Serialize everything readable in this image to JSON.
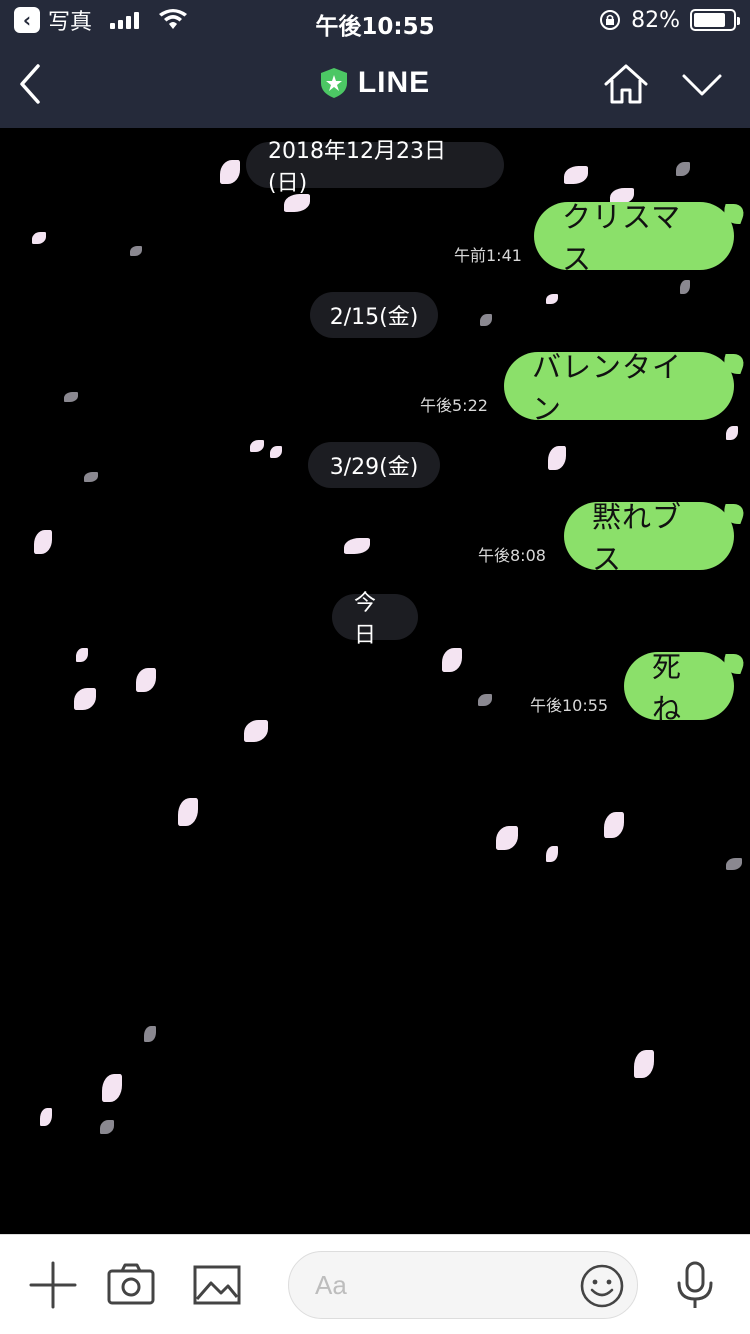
{
  "status_bar": {
    "back_app": "写真",
    "time": "午後10:55",
    "battery": "82%",
    "battery_level": 0.82
  },
  "header": {
    "title": "LINE"
  },
  "chat": {
    "dates": [
      "2018年12月23日(日)",
      "2/15(金)",
      "3/29(金)",
      "今日"
    ],
    "messages": [
      {
        "text": "クリスマス",
        "time": "午前1:41"
      },
      {
        "text": "バレンタイン",
        "time": "午後5:22"
      },
      {
        "text": "黙れブス",
        "time": "午後8:08"
      },
      {
        "text": "死ね",
        "time": "午後10:55"
      }
    ]
  },
  "composer": {
    "placeholder": "Aa"
  },
  "colors": {
    "bubble": "#8be06a",
    "header_bg": "#252a3a",
    "brand_green": "#4cc764"
  },
  "icons": [
    "plus-icon",
    "camera-icon",
    "image-icon",
    "emoji-icon",
    "microphone-icon",
    "home-icon",
    "chevron-down-icon",
    "back-arrow-icon"
  ]
}
